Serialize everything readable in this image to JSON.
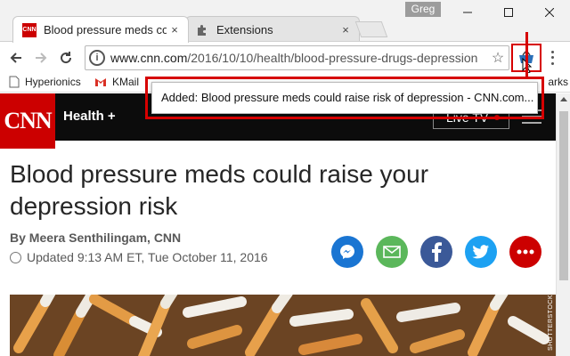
{
  "window": {
    "profile_name": "Greg",
    "minimize": "—",
    "maximize": "☐",
    "close": "✕"
  },
  "tabs": [
    {
      "label": "Blood pressure meds cou",
      "favicon_text": "CNN",
      "close": "×"
    },
    {
      "label": "Extensions",
      "close": "×"
    }
  ],
  "toolbar": {
    "url_host": "www.cnn.com",
    "url_path": "/2016/10/10/health/blood-pressure-drugs-depression",
    "star": "☆"
  },
  "bookmarks": [
    {
      "label": "Hyperionics"
    },
    {
      "label": "KMail"
    },
    {
      "label": "arks"
    }
  ],
  "popup": {
    "message": "Added: Blood pressure meds could raise risk of depression - CNN.com..."
  },
  "cnn": {
    "logo": "CNN",
    "section": "Health",
    "section_plus": "+",
    "live_tv": "Live TV"
  },
  "article": {
    "headline": "Blood pressure meds could raise your depression risk",
    "byline": "By Meera Senthilingam, CNN",
    "updated": "Updated 9:13 AM ET, Tue October 11, 2016",
    "photo_credit": "SHUTTERSTOCK",
    "share_buttons": [
      {
        "name": "messenger",
        "color": "#1a75d2"
      },
      {
        "name": "email",
        "color": "#5bb75b"
      },
      {
        "name": "facebook",
        "color": "#3b5998"
      },
      {
        "name": "twitter",
        "color": "#1da1f2"
      },
      {
        "name": "more",
        "color": "#cc0000"
      }
    ]
  },
  "colors": {
    "cnn_red": "#cc0000",
    "highlight_red": "#d60000",
    "header_black": "#0c0c0c"
  }
}
